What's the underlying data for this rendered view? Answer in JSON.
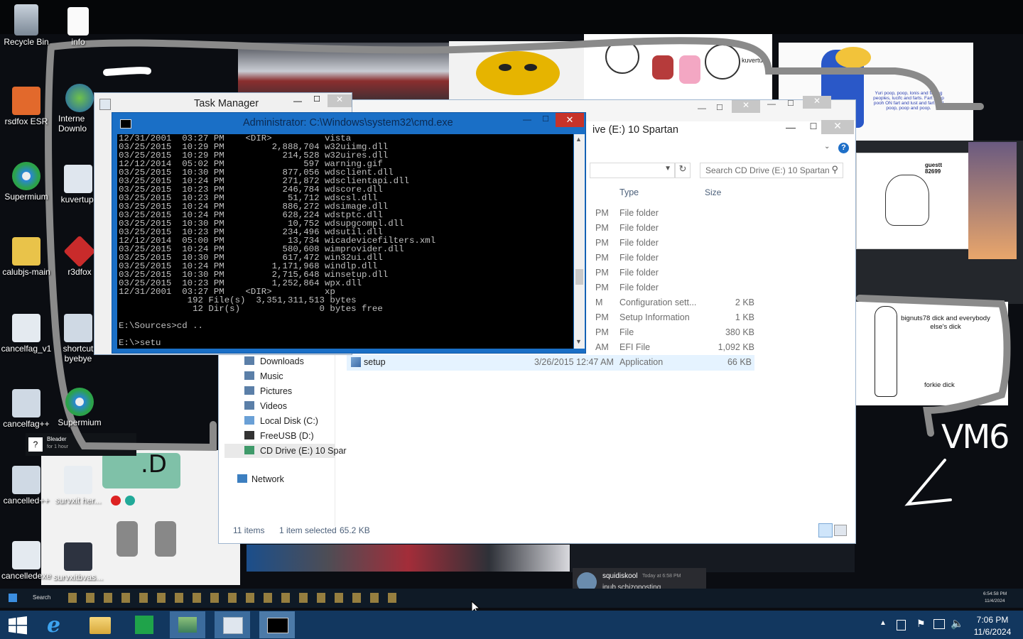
{
  "desktop": {
    "icons": [
      {
        "label": "Recycle Bin"
      },
      {
        "label": "info"
      },
      {
        "label": "rsdfox ESR"
      },
      {
        "label": "Interne Downlo"
      },
      {
        "label": "Supermium"
      },
      {
        "label": "kuvertupi"
      },
      {
        "label": "calubjs-main"
      },
      {
        "label": "r3dfox"
      },
      {
        "label": "cancelfag_v1"
      },
      {
        "label": "shortcut byebye"
      },
      {
        "label": "cancelfag++"
      },
      {
        "label": "Supermium"
      },
      {
        "label": "cancelled++"
      },
      {
        "label": "survxit her..."
      },
      {
        "label": "cancelledexe"
      },
      {
        "label": "survxitbvas..."
      }
    ],
    "collage": {
      "drawing_top_right_text": "Yuri poop, poop, lonis and farting peoples, lucifc and farts. Fart poop pooh ON fart and lust and fart and poop, poop and poop.",
      "kuvertu_label": "kuvertu",
      "guest_label": "guestt 82699",
      "drawing_label_1": "bignuts78 dick and everybody else's dick",
      "drawing_label_2": "forkie dick",
      "vm6_text": "VM6",
      "chat_user": "squidiskool",
      "chat_time": "Today at 6:58 PM",
      "chat_message": "inub schizoposting",
      "bleader_title": "Bleader",
      "bleader_sub": "for 1 hour",
      "mini_clock_time": "6:54:58 PM",
      "mini_clock_date": "11/4/2024"
    }
  },
  "task_manager": {
    "title": "Task Manager"
  },
  "cmd": {
    "title": "Administrator: C:\\Windows\\system32\\cmd.exe",
    "lines": [
      "12/31/2001  03:27 PM    <DIR>          vista",
      "03/25/2015  10:29 PM         2,888,704 w32uiimg.dll",
      "03/25/2015  10:29 PM           214,528 w32uires.dll",
      "12/12/2014  05:02 PM               597 warning.gif",
      "03/25/2015  10:30 PM           877,056 wdsclient.dll",
      "03/25/2015  10:24 PM           271,872 wdsclientapi.dll",
      "03/25/2015  10:23 PM           246,784 wdscore.dll",
      "03/25/2015  10:23 PM            51,712 wdscsl.dll",
      "03/25/2015  10:24 PM           886,272 wdsimage.dll",
      "03/25/2015  10:24 PM           628,224 wdstptc.dll",
      "03/25/2015  10:30 PM            10,752 wdsupgcompl.dll",
      "03/25/2015  10:23 PM           234,496 wdsutil.dll",
      "12/12/2014  05:00 PM            13,734 wicadevicefilters.xml",
      "03/25/2015  10:24 PM           580,608 wimprovider.dll",
      "03/25/2015  10:30 PM           617,472 win32ui.dll",
      "03/25/2015  10:24 PM         1,171,968 windlp.dll",
      "03/25/2015  10:30 PM         2,715,648 winsetup.dll",
      "03/25/2015  10:23 PM         1,252,864 wpx.dll",
      "12/31/2001  03:27 PM    <DIR>          xp",
      "             192 File(s)  3,351,311,513 bytes",
      "              12 Dir(s)               0 bytes free",
      "",
      "E:\\Sources>cd ..",
      "",
      "E:\\>setu"
    ]
  },
  "explorer": {
    "title": "ive (E:) 10 Spartan",
    "search_placeholder": "Search CD Drive (E:) 10 Spartan",
    "columns": {
      "type": "Type",
      "size": "Size"
    },
    "rows": [
      {
        "date": "PM",
        "type": "File folder",
        "size": ""
      },
      {
        "date": "PM",
        "type": "File folder",
        "size": ""
      },
      {
        "date": "PM",
        "type": "File folder",
        "size": ""
      },
      {
        "date": "PM",
        "type": "File folder",
        "size": ""
      },
      {
        "date": "PM",
        "type": "File folder",
        "size": ""
      },
      {
        "date": "PM",
        "type": "File folder",
        "size": ""
      },
      {
        "date": "M",
        "type": "Configuration sett...",
        "size": "2 KB"
      },
      {
        "date": "PM",
        "type": "Setup Information",
        "size": "1 KB"
      },
      {
        "date": "PM",
        "type": "File",
        "size": "380 KB"
      },
      {
        "date": "AM",
        "type": "EFI File",
        "size": "1,092 KB"
      }
    ],
    "selected_row": {
      "name": "setup",
      "date": "3/26/2015 12:47 AM",
      "type": "Application",
      "size": "66 KB"
    },
    "nav": [
      {
        "label": "Downloads"
      },
      {
        "label": "Music"
      },
      {
        "label": "Pictures"
      },
      {
        "label": "Videos"
      },
      {
        "label": "Local Disk (C:)"
      },
      {
        "label": "FreeUSB (D:)"
      },
      {
        "label": "CD Drive (E:) 10 Spar"
      }
    ],
    "network_label": "Network",
    "status": {
      "items": "11 items",
      "selected": "1 item selected",
      "size": "65.2 KB"
    }
  },
  "mini_taskbar": {
    "search_label": "Search"
  },
  "taskbar": {
    "time": "7:06 PM",
    "date": "11/6/2024"
  },
  "colors": {
    "taskbar": "#12375f",
    "cmd_frame": "#1a6fc6",
    "selection": "#cce8ff"
  }
}
